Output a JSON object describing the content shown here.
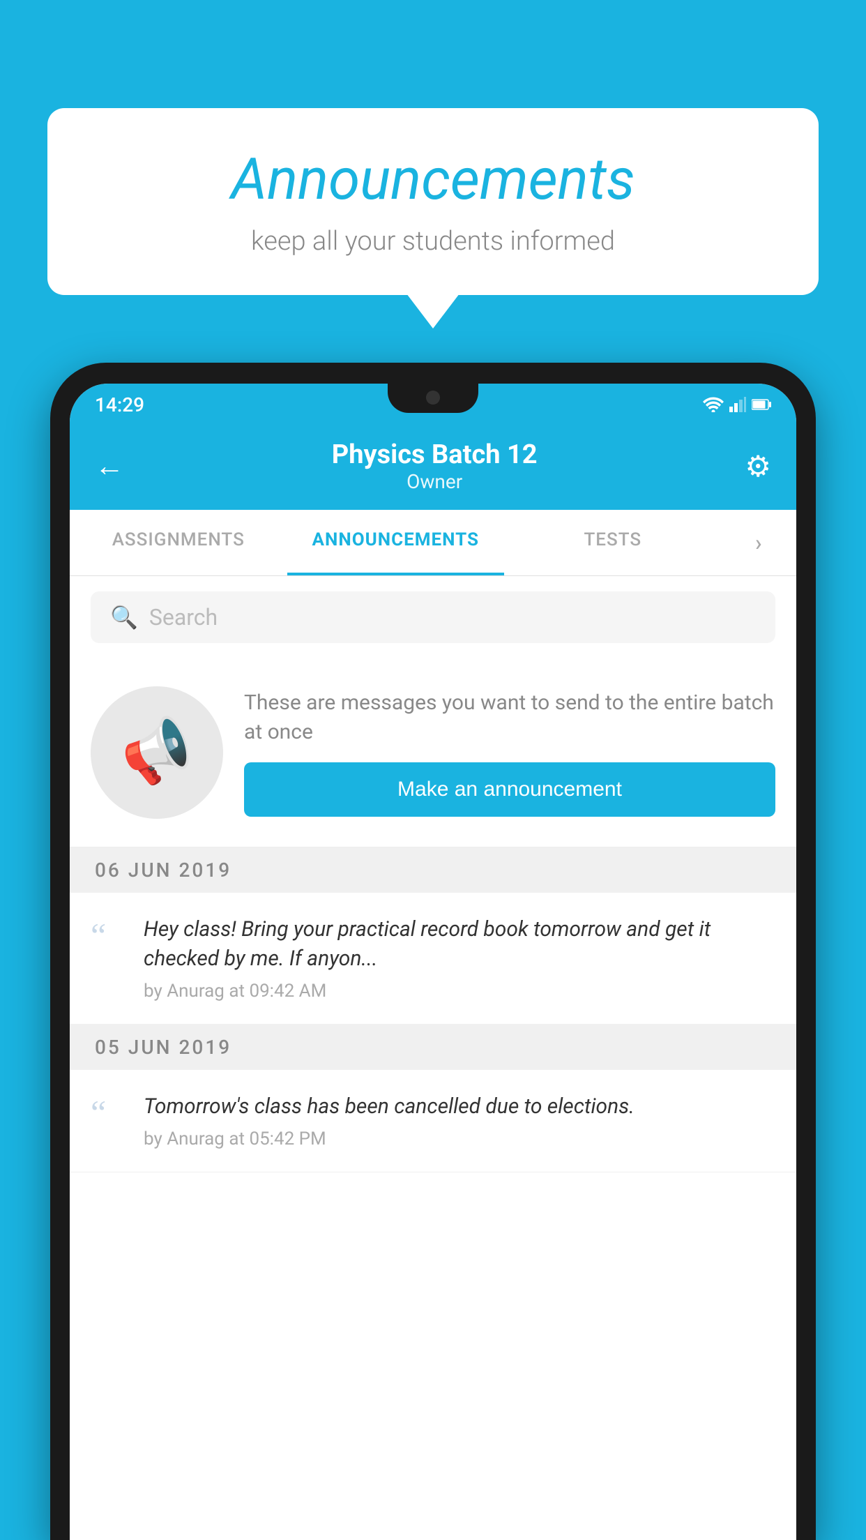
{
  "background_color": "#1ab3e0",
  "speech_bubble": {
    "title": "Announcements",
    "subtitle": "keep all your students informed"
  },
  "status_bar": {
    "time": "14:29"
  },
  "app_header": {
    "title": "Physics Batch 12",
    "subtitle": "Owner"
  },
  "tabs": [
    {
      "label": "ASSIGNMENTS",
      "active": false
    },
    {
      "label": "ANNOUNCEMENTS",
      "active": true
    },
    {
      "label": "TESTS",
      "active": false
    },
    {
      "label": "...",
      "active": false
    }
  ],
  "search": {
    "placeholder": "Search"
  },
  "promo": {
    "description": "These are messages you want to send to the entire batch at once",
    "button_label": "Make an announcement"
  },
  "announcements": [
    {
      "date": "06  JUN  2019",
      "text": "Hey class! Bring your practical record book tomorrow and get it checked by me. If anyon...",
      "meta": "by Anurag at 09:42 AM"
    },
    {
      "date": "05  JUN  2019",
      "text": "Tomorrow's class has been cancelled due to elections.",
      "meta": "by Anurag at 05:42 PM"
    }
  ]
}
